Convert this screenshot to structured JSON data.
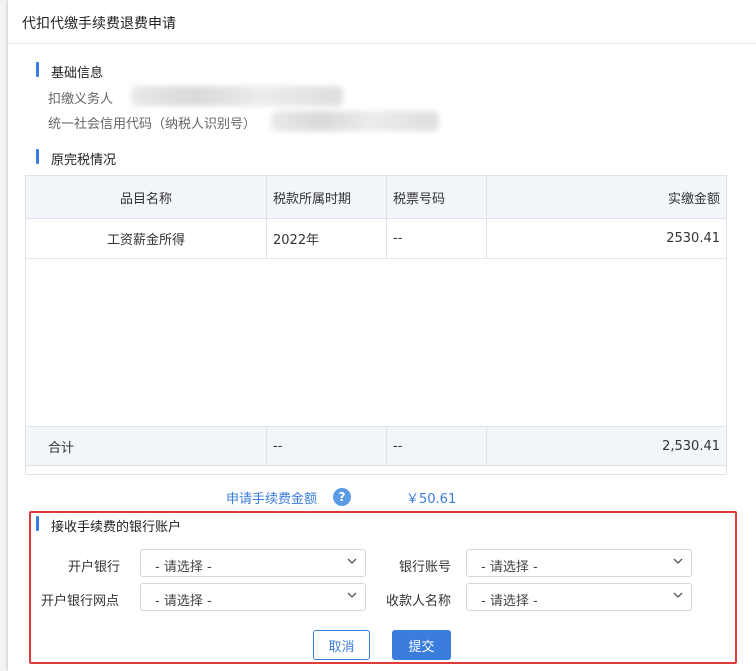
{
  "dialog": {
    "title": "代扣代缴手续费退费申请"
  },
  "basic_info": {
    "section_title": "基础信息",
    "withholder_label": "扣缴义务人",
    "credit_code_label": "统一社会信用代码（纳税人识别号）"
  },
  "tax_paid": {
    "section_title": "原完税情况",
    "columns": [
      "品目名称",
      "税款所属时期",
      "税票号码",
      "实缴金额"
    ],
    "rows": [
      [
        "工资薪金所得",
        "2022年",
        "--",
        "2530.41"
      ]
    ],
    "total": [
      "合计",
      "--",
      "--",
      "2,530.41"
    ]
  },
  "fee": {
    "label": "申请手续费金额",
    "help_icon": "?",
    "value": "￥50.61"
  },
  "bank_account": {
    "section_title": "接收手续费的银行账户",
    "fields": {
      "bank_label": "开户银行",
      "bank_value": "- 请选择 -",
      "account_label": "银行账号",
      "account_value": "- 请选择 -",
      "branch_label": "开户银行网点",
      "branch_value": "- 请选择 -",
      "payee_label": "收款人名称",
      "payee_value": "- 请选择 -"
    }
  },
  "actions": {
    "cancel": "取消",
    "submit": "提交"
  },
  "colors": {
    "accent": "#3b7ddd",
    "highlight_border": "#e03b3b"
  }
}
